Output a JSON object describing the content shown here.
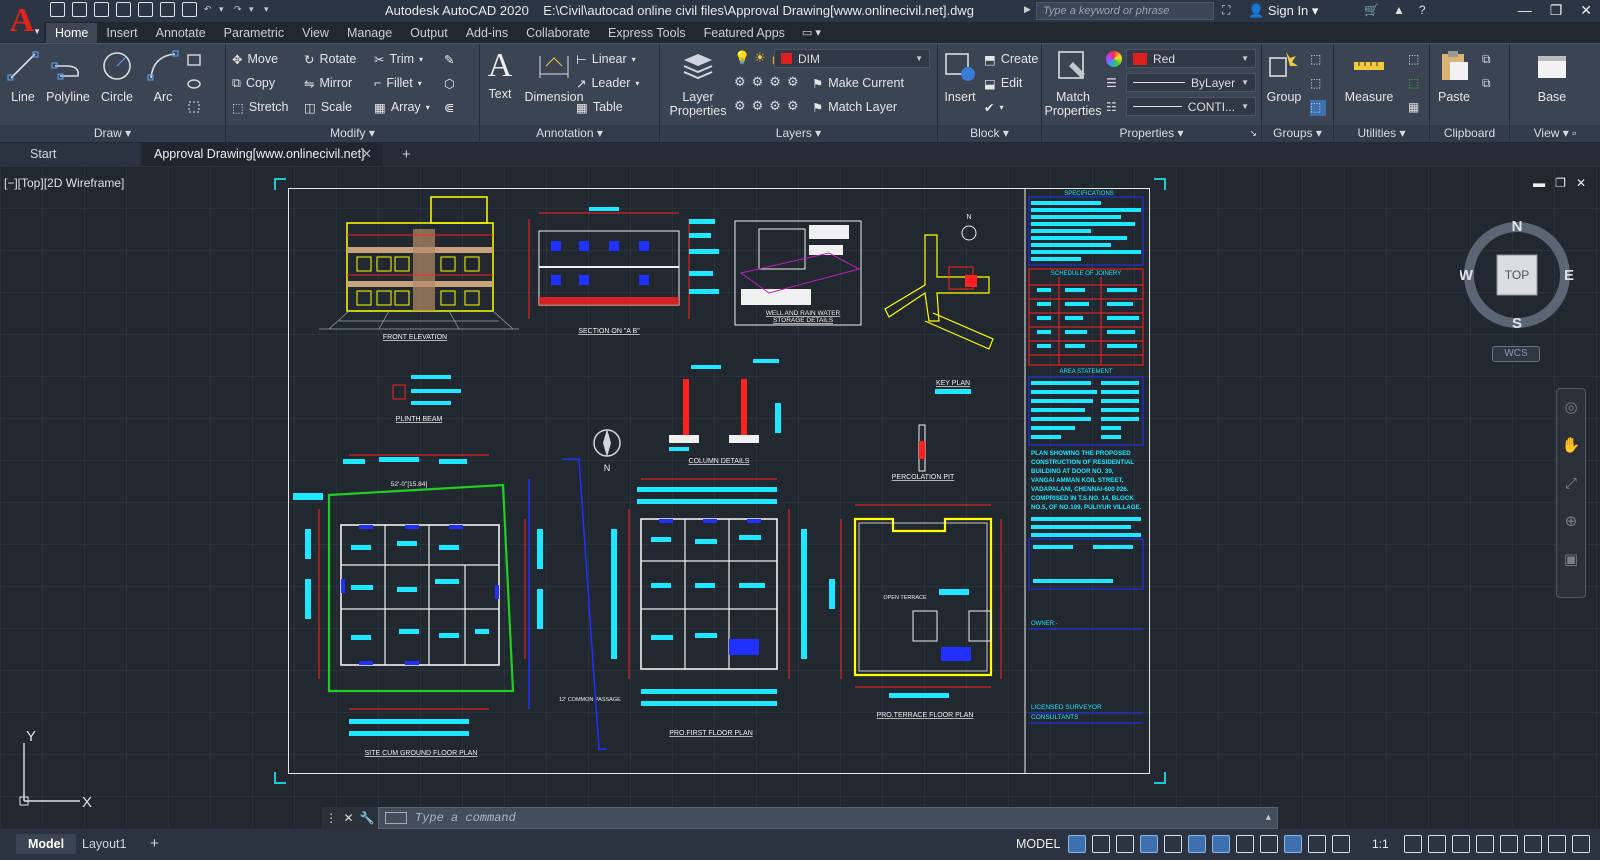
{
  "titlebar": {
    "app_title": "Autodesk AutoCAD 2020",
    "file_path": "E:\\Civil\\autocad online civil files\\Approval Drawing[www.onlinecivil.net].dwg",
    "search_placeholder": "Type a keyword or phrase",
    "signin_label": "Sign In"
  },
  "ribbon_tabs": [
    "Home",
    "Insert",
    "Annotate",
    "Parametric",
    "View",
    "Manage",
    "Output",
    "Add-ins",
    "Collaborate",
    "Express Tools",
    "Featured Apps"
  ],
  "ribbon": {
    "draw": {
      "title": "Draw",
      "line": "Line",
      "polyline": "Polyline",
      "circle": "Circle",
      "arc": "Arc"
    },
    "modify": {
      "title": "Modify",
      "move": "Move",
      "rotate": "Rotate",
      "trim": "Trim",
      "copy": "Copy",
      "mirror": "Mirror",
      "fillet": "Fillet",
      "stretch": "Stretch",
      "scale": "Scale",
      "array": "Array"
    },
    "annotation": {
      "title": "Annotation",
      "text": "Text",
      "dimension": "Dimension",
      "linear": "Linear",
      "leader": "Leader",
      "table": "Table"
    },
    "layers": {
      "title": "Layers",
      "layer_properties_1": "Layer",
      "layer_properties_2": "Properties",
      "current_layer": "DIM",
      "make_current": "Make Current",
      "match_layer": "Match Layer"
    },
    "block": {
      "title": "Block",
      "insert": "Insert",
      "create": "Create",
      "edit": "Edit"
    },
    "properties": {
      "title": "Properties",
      "match_1": "Match",
      "match_2": "Properties",
      "color": "Red",
      "lineweight": "ByLayer",
      "linetype": "CONTI..."
    },
    "groups": {
      "title": "Groups",
      "group": "Group"
    },
    "utilities": {
      "title": "Utilities",
      "measure": "Measure"
    },
    "clipboard": {
      "title": "Clipboard",
      "paste": "Paste"
    },
    "view": {
      "title": "View",
      "base": "Base"
    }
  },
  "doc_tabs": {
    "start": "Start",
    "active": "Approval Drawing[www.onlinecivil.net]"
  },
  "viewport": {
    "label": "[−][Top][2D Wireframe]"
  },
  "drawing_labels": {
    "front_elevation": "FRONT  ELEVATION",
    "section": "SECTION  ON  \"A  B\"",
    "well": "WELL AND RAIN WATER",
    "well2": "STORAGE  DETAILS",
    "key_plan": "KEY   PLAN",
    "plinth_beam": "PLINTH   BEAM",
    "column_details": "COLUMN   DETAILS",
    "percolation_pit": "PERCOLATION  PIT",
    "site_plan": "SITE   CUM   GROUND   FLOOR   PLAN",
    "first_floor": "PRO.FIRST   FLOOR   PLAN",
    "terrace": "PRO.TERRACE  FLOOR  PLAN",
    "specifications": "SPECIFICATIONS",
    "schedule": "SCHEDULE  OF  JOINERY",
    "area_statement": "AREA STATEMENT",
    "owner": "OWNER:-",
    "surveyor": "LICENSED SURVEYOR",
    "consultants": "CONSULTANTS",
    "north": "N",
    "open_terrace": "OPEN TERRACE",
    "dim_site": "52'-0\"[15.84]",
    "common_passage": "12' COMMON PASSAGE"
  },
  "plan_note": [
    "PLAN  SHOWING  THE  PROPOSED",
    "CONSTRUCTION  OF  RESIDENTIAL",
    "BUILDING AT DOOR  NO. 39,",
    "VANGAI AMMAN KOIL STREET,",
    "VADAPALANI,  CHENNAI-600 026.",
    "COMPRISED IN T.S.NO. 14, BLOCK",
    "NO.5,  OF NO.109, PULIYUR VILLAGE."
  ],
  "viewcube": {
    "n": "N",
    "s": "S",
    "e": "E",
    "w": "W",
    "top": "TOP",
    "wcs": "WCS"
  },
  "ucs": {
    "x": "X",
    "y": "Y"
  },
  "command": {
    "placeholder": "Type  a  command"
  },
  "status": {
    "model_tab": "Model",
    "layout_tab": "Layout1",
    "model_label": "MODEL",
    "scale": "1:1"
  },
  "colors": {
    "cyan": "#1ee8ff",
    "yellow": "#ffff00",
    "red": "#ff2020",
    "blue": "#2030ff",
    "green": "#20d020",
    "white": "#f0f0f0"
  }
}
